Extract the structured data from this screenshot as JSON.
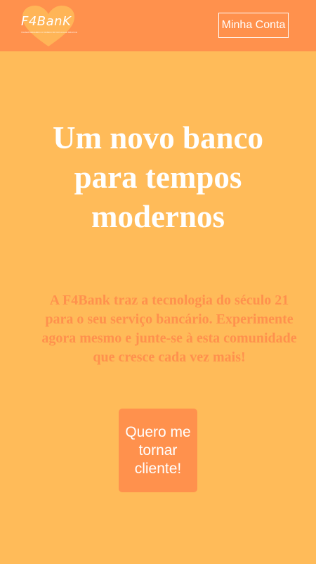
{
  "header": {
    "logo_text": "F4BanK",
    "logo_tagline": "TRANSFORMANDO O MUNDO EM UM LUGAR MELHOR",
    "account_label": "Minha Conta"
  },
  "hero": {
    "headline": "Um novo banco para tempos modernos",
    "description": "A F4Bank traz a tecnologia do século 21 para o seu serviço bancário. Experimente agora mesmo e junte-se à esta comunidade que cresce cada vez mais!",
    "cta_label": "Quero me tornar cliente!"
  },
  "colors": {
    "background": "#FFBB59",
    "header": "#FF914D",
    "accent": "#FF914D",
    "text_light": "#FFFFFF"
  }
}
